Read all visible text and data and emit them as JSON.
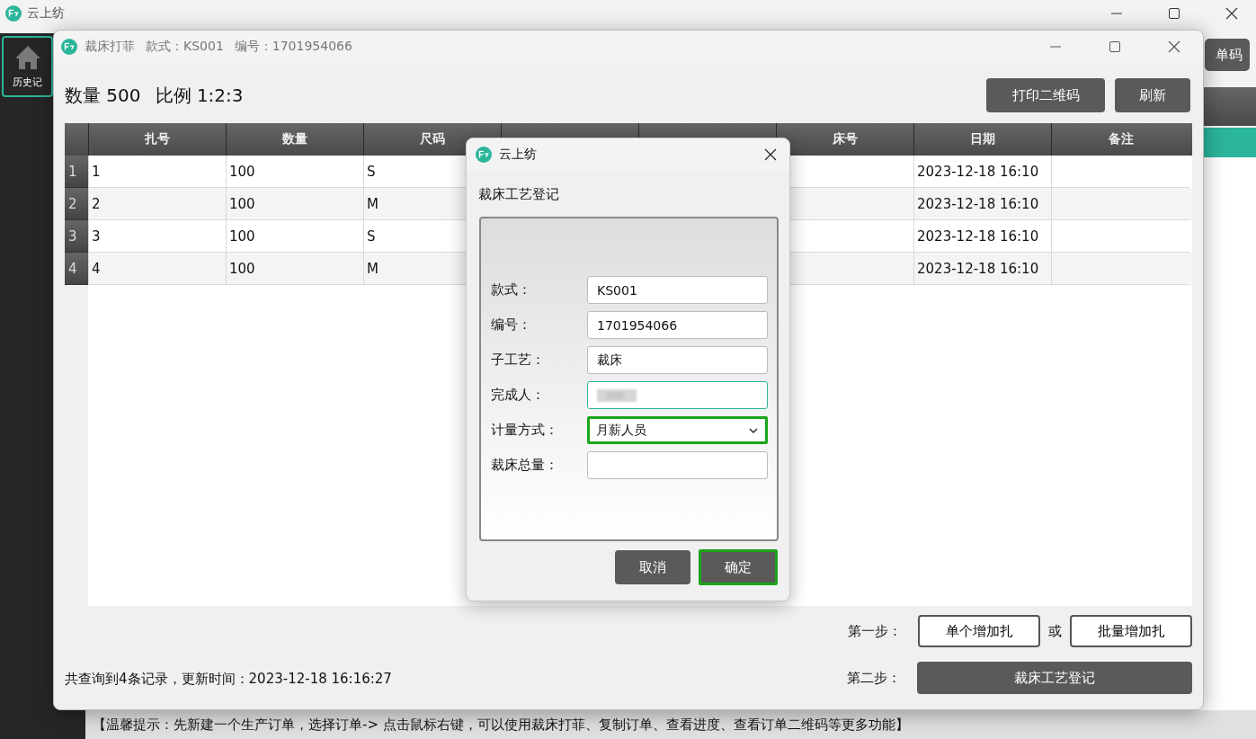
{
  "app": {
    "title": "云上纺",
    "sidebar": [
      {
        "label": "历史记",
        "selected": true
      }
    ],
    "toolbar_button": "单码",
    "hint": "【温馨提示：先新建一个生产订单，选择订单-> 点击鼠标右键，可以使用裁床打菲、复制订单、查看进度、查看订单二维码等更多功能】"
  },
  "window": {
    "title_parts": [
      "裁床打菲",
      "款式：KS001",
      "编号：1701954066"
    ],
    "summary": [
      "数量 500",
      "比例 1:2:3"
    ],
    "buttons": [
      "打印二维码",
      "刷新"
    ],
    "table": {
      "columns": [
        "扎号",
        "数量",
        "尺码",
        "床号",
        "日期",
        "备注"
      ],
      "rows": [
        {
          "index": "1",
          "bundle_no": "1",
          "quantity": "100",
          "size": "S",
          "date": "2023-12-18 16:10"
        },
        {
          "index": "2",
          "bundle_no": "2",
          "quantity": "100",
          "size": "M",
          "date": "2023-12-18 16:10"
        },
        {
          "index": "3",
          "bundle_no": "3",
          "quantity": "100",
          "size": "S",
          "date": "2023-12-18 16:10"
        },
        {
          "index": "4",
          "bundle_no": "4",
          "quantity": "100",
          "size": "M",
          "date": "2023-12-18 16:10"
        }
      ]
    },
    "step1": {
      "label": "第一步：",
      "buttons": [
        "单个增加扎",
        "批量增加扎"
      ],
      "separator": "或"
    },
    "step2": {
      "label": "第二步：",
      "button": "裁床工艺登记"
    },
    "status": "共查询到4条记录，更新时间：2023-12-18 16:16:27"
  },
  "dialog": {
    "title": "云上纺",
    "heading": "裁床工艺登记",
    "fields": [
      {
        "kind": "text",
        "label": "款式：",
        "value": "KS001",
        "focused": false,
        "highlighted": false
      },
      {
        "kind": "text",
        "label": "编号：",
        "value": "1701954066",
        "focused": false,
        "highlighted": false
      },
      {
        "kind": "text",
        "label": "子工艺：",
        "value": "裁床",
        "focused": false,
        "highlighted": false
      },
      {
        "kind": "blurred",
        "label": "完成人：",
        "focused": true,
        "highlighted": false
      },
      {
        "kind": "select",
        "label": "计量方式：",
        "value": "月薪人员",
        "focused": false,
        "highlighted": true
      },
      {
        "kind": "text",
        "label": "裁床总量：",
        "focused": false,
        "highlighted": false
      }
    ],
    "buttons": [
      {
        "label": "取消",
        "highlighted": false
      },
      {
        "label": "确定",
        "highlighted": true
      }
    ]
  }
}
